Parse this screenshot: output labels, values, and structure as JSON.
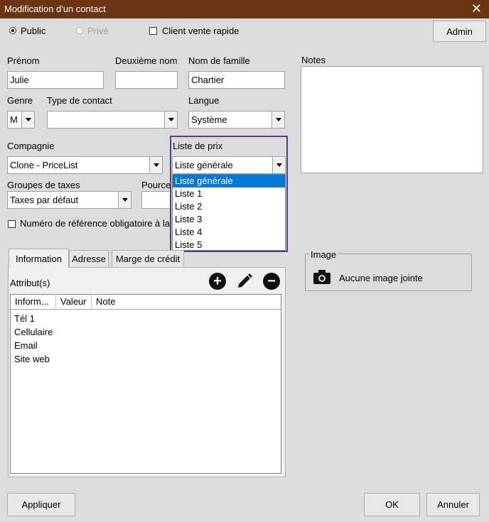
{
  "window": {
    "title": "Modification d'un contact",
    "close": "✕"
  },
  "visibility": {
    "public": "Public",
    "prive": "Privé"
  },
  "client_vente_rapide": "Client vente rapide",
  "admin_button": "Admin",
  "fields": {
    "prenom": {
      "label": "Prénom",
      "value": "Julie"
    },
    "deuxieme_nom": {
      "label": "Deuxième nom",
      "value": ""
    },
    "nom_famille": {
      "label": "Nom de famille",
      "value": "Chartier"
    },
    "genre": {
      "label": "Genre",
      "value": "M"
    },
    "type_contact": {
      "label": "Type de contact",
      "value": ""
    },
    "langue": {
      "label": "Langue",
      "value": "Système"
    },
    "compagnie": {
      "label": "Compagnie",
      "value": "Clone - PriceList"
    },
    "liste_prix": {
      "label": "Liste de prix",
      "value": "Liste générale"
    },
    "groupes_taxes": {
      "label": "Groupes de taxes",
      "value": "Taxes par défaut"
    },
    "pource": {
      "label": "Pource"
    }
  },
  "notes_label": "Notes",
  "numero_reference": "Numéro de référence obligatoire à la",
  "price_list_options": [
    "Liste générale",
    "Liste 1",
    "Liste 2",
    "Liste 3",
    "Liste 4",
    "Liste 5"
  ],
  "tabs": [
    "Information",
    "Adresse",
    "Marge de crédit"
  ],
  "attributs_label": "Attribut(s)",
  "table": {
    "columns": [
      "Inform...",
      "Valeur",
      "Note"
    ],
    "rows": [
      "Tél 1",
      "Cellulaire",
      "Email",
      "Site web"
    ]
  },
  "image": {
    "label": "Image",
    "none": "Aucune image jointe"
  },
  "buttons": {
    "appliquer": "Appliquer",
    "ok": "OK",
    "annuler": "Annuler"
  }
}
